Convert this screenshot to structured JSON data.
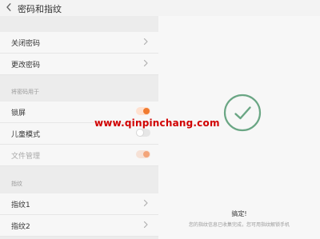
{
  "header": {
    "title": "密码和指纹"
  },
  "password_section": {
    "items": [
      {
        "label": "关闭密码"
      },
      {
        "label": "更改密码"
      }
    ]
  },
  "usage_section": {
    "label": "将密码用于",
    "items": [
      {
        "label": "锁屏",
        "toggle": "on"
      },
      {
        "label": "儿童模式",
        "toggle": "off"
      },
      {
        "label": "文件管理",
        "toggle": "on-disabled"
      }
    ]
  },
  "fingerprint_section": {
    "label": "指纹",
    "items": [
      {
        "label": "指纹1"
      },
      {
        "label": "指纹2"
      }
    ]
  },
  "watermark": {
    "text": "www.qinpinchang.com"
  },
  "success_panel": {
    "title": "搞定!",
    "description": "您的指纹信息已收集完成，您可用指纹解锁手机"
  },
  "colors": {
    "accent": "#f07a2f",
    "success_ring": "#6aa684",
    "watermark": "#d10000"
  },
  "icons": {
    "back": "chevron-left-icon",
    "row_chevron": "chevron-right-icon",
    "success": "check-circle-icon"
  }
}
